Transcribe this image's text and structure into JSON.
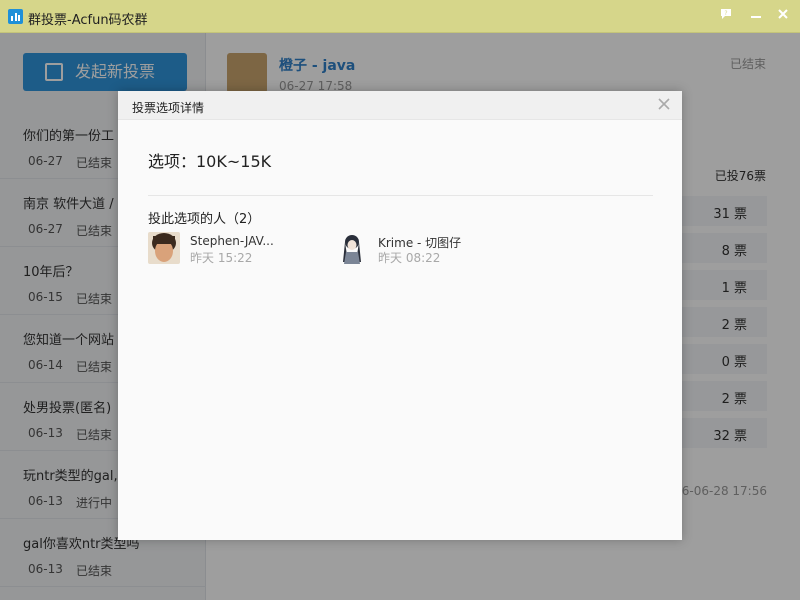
{
  "window": {
    "title": "群投票-Acfun码农群",
    "icon": "bar-chart-icon"
  },
  "sidebar": {
    "new_vote_label": "发起新投票",
    "items": [
      {
        "title": "你们的第一份工",
        "date": "06-27",
        "status": "已结束"
      },
      {
        "title": "南京 软件大道 /",
        "date": "06-27",
        "status": "已结束"
      },
      {
        "title": "10年后？",
        "date": "06-15",
        "status": "已结束"
      },
      {
        "title": "您知道一个网站",
        "date": "06-14",
        "status": "已结束"
      },
      {
        "title": "处男投票(匿名)",
        "date": "06-13",
        "status": "已结束"
      },
      {
        "title": "玩ntr类型的gal,",
        "date": "06-13",
        "status": "进行中"
      },
      {
        "title": "gal你喜欢ntr类型吗",
        "date": "06-13",
        "status": "已结束"
      }
    ]
  },
  "main": {
    "author": "橙子 - java",
    "date": "06-27 17:58",
    "status": "已结束",
    "total": "已投76票",
    "counts": [
      "31 票",
      "8 票",
      "1 票",
      "2 票",
      "0 票",
      "2 票",
      "32 票"
    ],
    "footer_time": "16-06-28 17:56"
  },
  "dialog": {
    "title": "投票选项详情",
    "option_title": "选项：10K~15K",
    "voters_label": "投此选项的人（2）",
    "voters": [
      {
        "name": "Stephen-JAV...",
        "time": "昨天 15:22"
      },
      {
        "name": "Krime - 切图仔",
        "time": "昨天 08:22"
      }
    ]
  }
}
